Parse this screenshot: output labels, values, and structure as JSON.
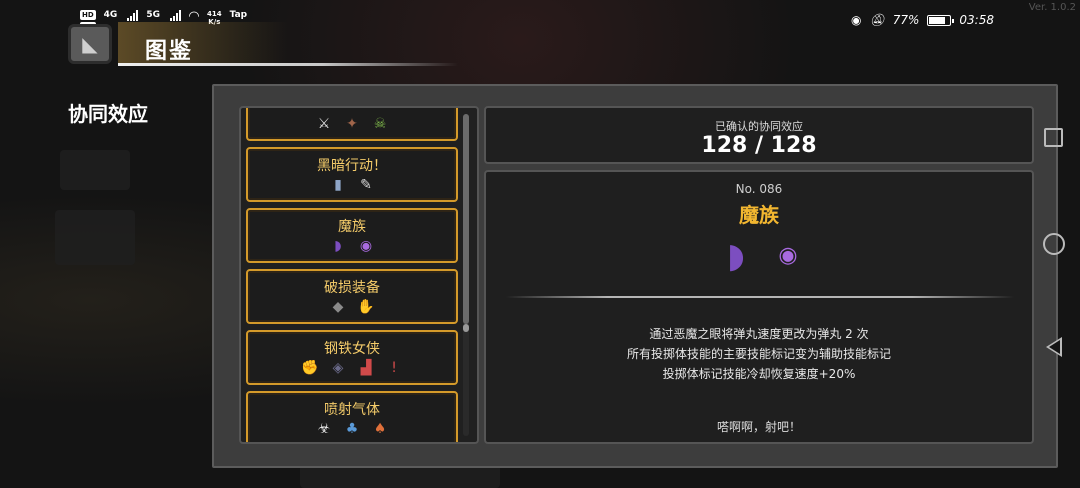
{
  "status_bar": {
    "hd1": "HD",
    "hd2": "HD",
    "net1": "4G",
    "net2": "5G",
    "speed": "414",
    "speed_unit": "K/s",
    "app": "Tap",
    "battery_pct": "77%",
    "battery_level": 0.77,
    "time": "03:58"
  },
  "version": "Ver. 1.0.2",
  "header": {
    "title": "图鉴"
  },
  "section_title": "协同效应",
  "counter": {
    "label": "已确认的协同效应",
    "value": "128 / 128"
  },
  "list": [
    {
      "name": "",
      "icons": [
        "sword-icon",
        "branch-icon",
        "skull-icon"
      ],
      "glyphs": [
        "⚔",
        "✦",
        "☠"
      ],
      "colors": [
        "#e0e0e0",
        "#a0654a",
        "#7fb84a"
      ]
    },
    {
      "name": "黑暗行动！",
      "icons": [
        "bottle-icon",
        "syringe-icon"
      ],
      "glyphs": [
        "▮",
        "✎"
      ],
      "colors": [
        "#8fa6c8",
        "#d8d8d8"
      ]
    },
    {
      "name": "魔族",
      "icons": [
        "horn-icon",
        "demon-eye-icon"
      ],
      "glyphs": [
        "◗",
        "◉"
      ],
      "colors": [
        "#7c4ec0",
        "#a86ae0"
      ]
    },
    {
      "name": "破损装备",
      "icons": [
        "helmet-icon",
        "gauntlet-icon"
      ],
      "glyphs": [
        "◆",
        "✋"
      ],
      "colors": [
        "#8a8a8a",
        "#c0c0c0"
      ]
    },
    {
      "name": "钢铁女侠",
      "icons": [
        "glove-icon",
        "armor-icon",
        "boots-icon",
        "dagger-icon"
      ],
      "glyphs": [
        "✊",
        "◈",
        "▟",
        "!"
      ],
      "colors": [
        "#b84a3a",
        "#6a6a8a",
        "#d04a4a",
        "#d04a4a"
      ]
    },
    {
      "name": "喷射气体",
      "icons": [
        "biohazard-icon",
        "blue-mushroom-icon",
        "red-mushroom-icon"
      ],
      "glyphs": [
        "☣",
        "♣",
        "♠"
      ],
      "colors": [
        "#e8e8e8",
        "#5a9ad8",
        "#e0703a"
      ]
    }
  ],
  "detail": {
    "number": "No. 086",
    "name": "魔族",
    "icons": [
      "horn-icon",
      "demon-eye-icon"
    ],
    "description": [
      "通过恶魔之眼将弹丸速度更改为弹丸 2 次",
      "所有投掷体技能的主要技能标记变为辅助技能标记",
      "投掷体标记技能冷却恢复速度+20%"
    ],
    "quote": "嗒啊啊，射吧！"
  }
}
